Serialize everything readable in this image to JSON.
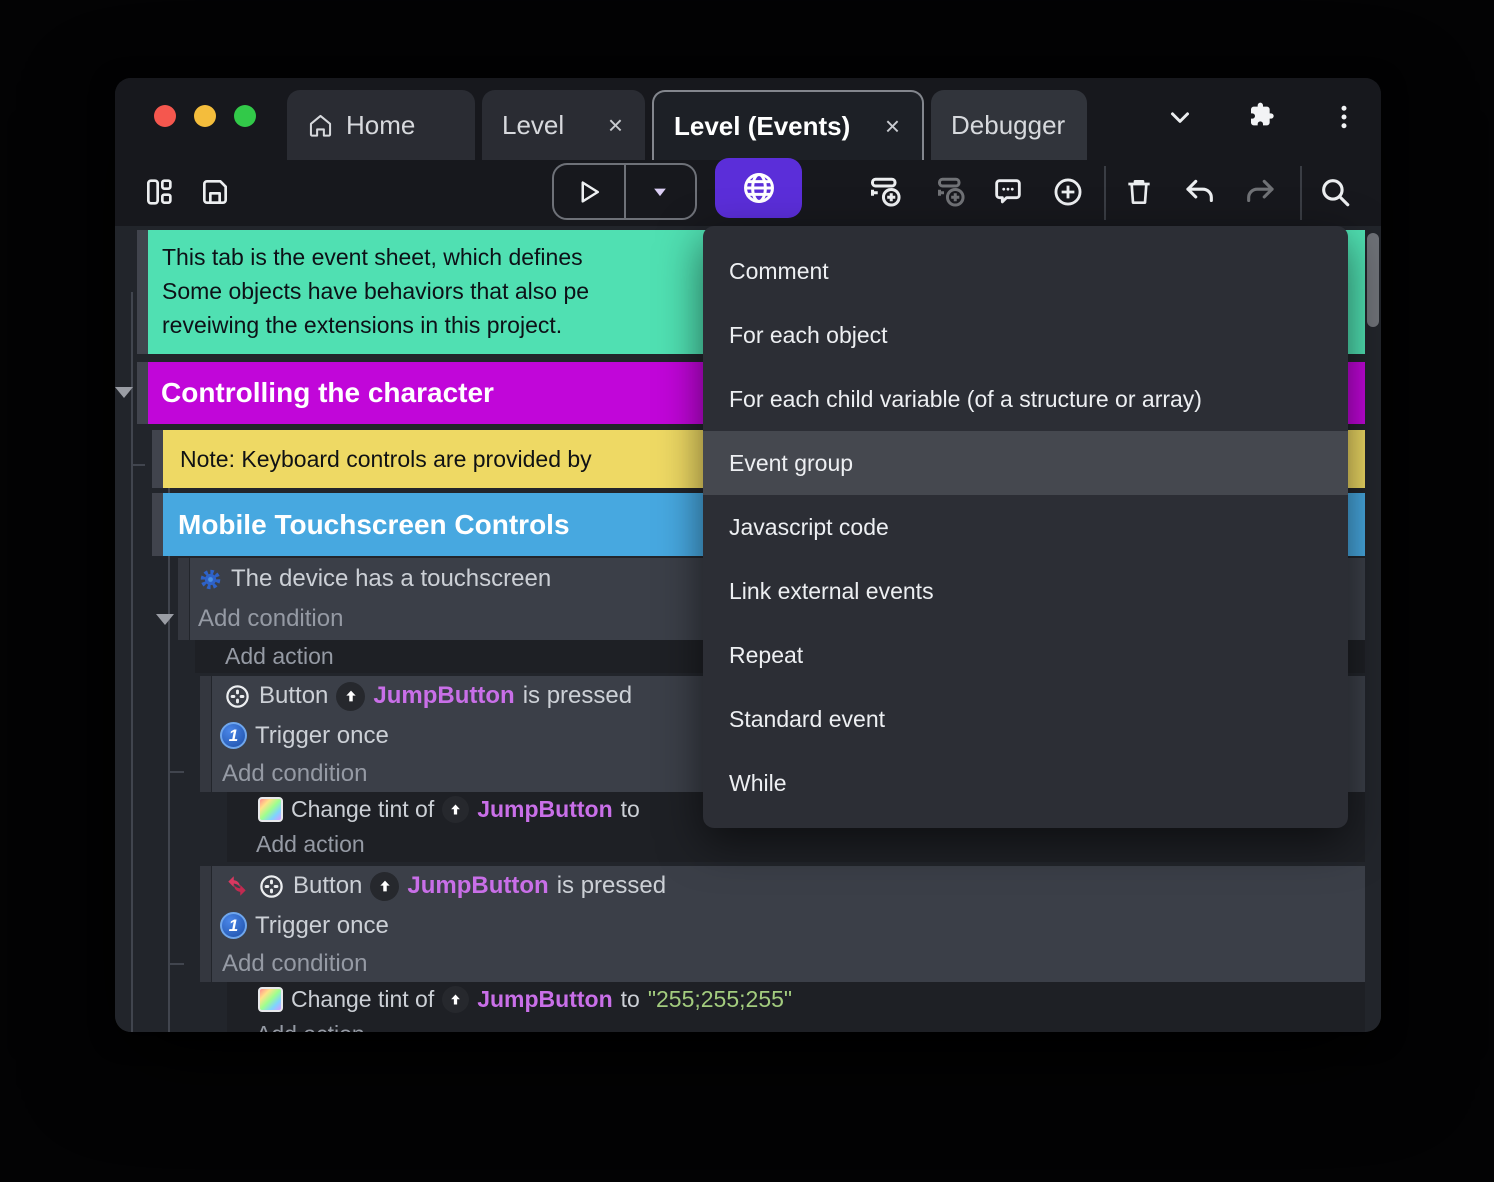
{
  "titlebar": {
    "tabs": [
      {
        "label": "Home"
      },
      {
        "label": "Level"
      },
      {
        "label": "Level (Events)"
      },
      {
        "label": "Debugger"
      }
    ],
    "close_glyph": "×"
  },
  "event_sheet": {
    "comment_top": {
      "lines": [
        "This tab is the event sheet, which defines",
        "Some objects have behaviors that also pe",
        "reveiwing the extensions in this project."
      ]
    },
    "group1": {
      "label": "Controlling the character"
    },
    "note": {
      "text": "Note: Keyboard controls are provided by"
    },
    "group2": {
      "label": "Mobile Touchscreen Controls"
    },
    "strings": {
      "touchscreen_condition": "The device has a touchscreen",
      "add_condition": "Add condition",
      "add_action": "Add action",
      "button_word": "Button",
      "object_name": "JumpButton",
      "pressed_suffix": "is pressed",
      "trigger_once": "Trigger once",
      "change_tint_prefix": "Change tint of",
      "to_word": "to",
      "tint_value": "\"255;255;255\""
    }
  },
  "context_menu": {
    "items": [
      "Comment",
      "For each object",
      "For each child variable (of a structure or array)",
      "Event group",
      "Javascript code",
      "Link external events",
      "Repeat",
      "Standard event",
      "While"
    ],
    "highlighted": "Event group"
  },
  "colors": {
    "accent_purple": "#5b2ed9",
    "comment_teal": "#50e0b2",
    "group_magenta": "#c106d9",
    "note_yellow": "#eed964",
    "group_blue": "#47a8e0",
    "object_orchid": "#c96fe8",
    "string_green": "#a3cc7e",
    "traffic_red": "#f5574e",
    "traffic_yellow": "#f4bd3c",
    "traffic_green": "#32c949"
  }
}
